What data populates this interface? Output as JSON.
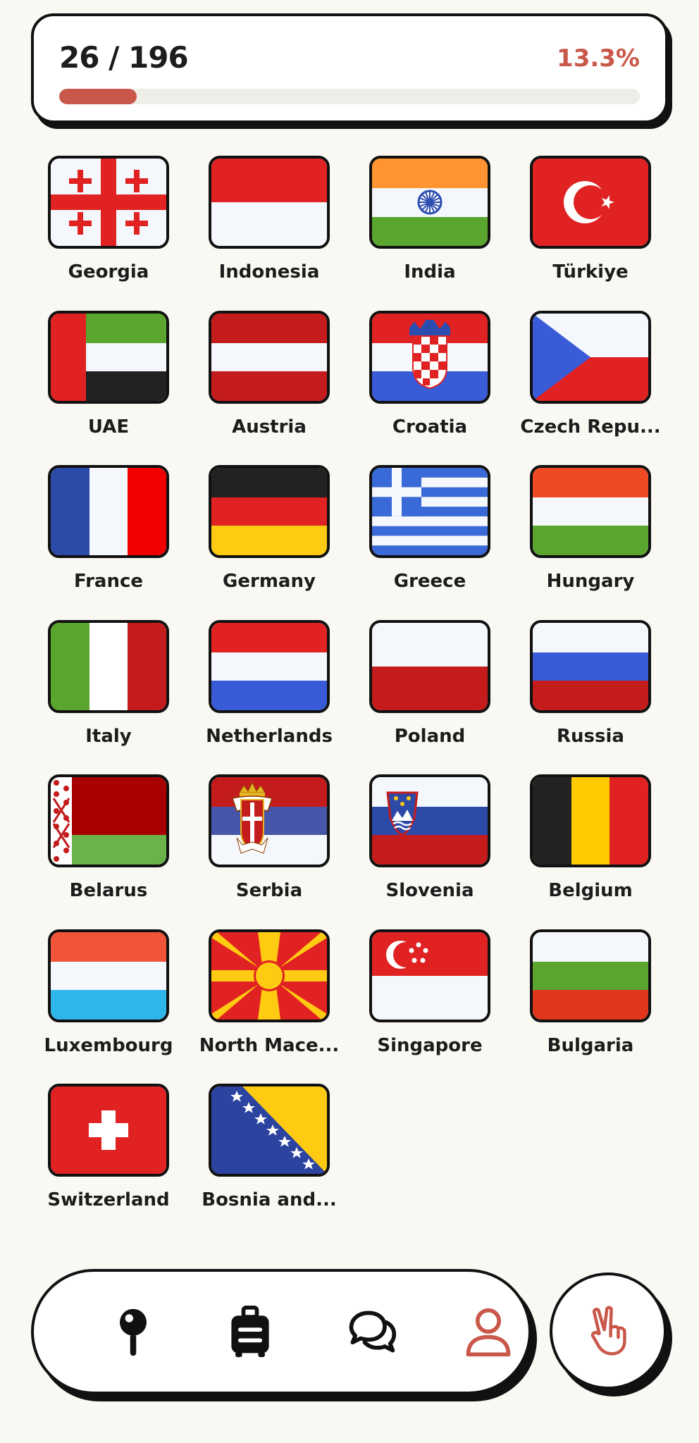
{
  "progress": {
    "count_label": "26 / 196",
    "percent_label": "13.3%",
    "visited": 26,
    "total": 196,
    "fraction": 0.133
  },
  "countries": [
    {
      "name": "Georgia",
      "flag": "georgia-flag"
    },
    {
      "name": "Indonesia",
      "flag": "indonesia-flag"
    },
    {
      "name": "India",
      "flag": "india-flag"
    },
    {
      "name": "Türkiye",
      "flag": "turkiye-flag"
    },
    {
      "name": "UAE",
      "flag": "uae-flag"
    },
    {
      "name": "Austria",
      "flag": "austria-flag"
    },
    {
      "name": "Croatia",
      "flag": "croatia-flag"
    },
    {
      "name": "Czech Repu...",
      "flag": "czech-republic-flag"
    },
    {
      "name": "France",
      "flag": "france-flag"
    },
    {
      "name": "Germany",
      "flag": "germany-flag"
    },
    {
      "name": "Greece",
      "flag": "greece-flag"
    },
    {
      "name": "Hungary",
      "flag": "hungary-flag"
    },
    {
      "name": "Italy",
      "flag": "italy-flag"
    },
    {
      "name": "Netherlands",
      "flag": "netherlands-flag"
    },
    {
      "name": "Poland",
      "flag": "poland-flag"
    },
    {
      "name": "Russia",
      "flag": "russia-flag"
    },
    {
      "name": "Belarus",
      "flag": "belarus-flag"
    },
    {
      "name": "Serbia",
      "flag": "serbia-flag"
    },
    {
      "name": "Slovenia",
      "flag": "slovenia-flag"
    },
    {
      "name": "Belgium",
      "flag": "belgium-flag"
    },
    {
      "name": "Luxembourg",
      "flag": "luxembourg-flag"
    },
    {
      "name": "North Mace...",
      "flag": "north-macedonia-flag"
    },
    {
      "name": "Singapore",
      "flag": "singapore-flag"
    },
    {
      "name": "Bulgaria",
      "flag": "bulgaria-flag"
    },
    {
      "name": "Switzerland",
      "flag": "switzerland-flag"
    },
    {
      "name": "Bosnia and...",
      "flag": "bosnia-and-herzegovina-flag"
    }
  ],
  "nav": {
    "items": [
      {
        "icon": "map-pin-icon",
        "active": false
      },
      {
        "icon": "luggage-icon",
        "active": false
      },
      {
        "icon": "chat-bubbles-icon",
        "active": false
      },
      {
        "icon": "profile-icon",
        "active": true
      }
    ],
    "wave_icon": "peace-hand-icon"
  },
  "colors": {
    "accent": "#c9584a",
    "inactive_icon": "#111111",
    "background": "#faf8f3",
    "track": "#efede8"
  }
}
